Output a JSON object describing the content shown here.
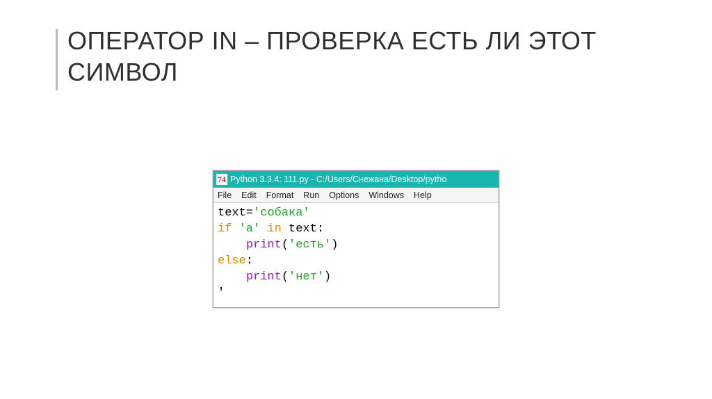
{
  "slide": {
    "title": "ОПЕРАТОР IN – ПРОВЕРКА ЕСТЬ ЛИ ЭТОТ СИМВОЛ"
  },
  "window": {
    "tk_icon": "74",
    "title": "Python 3.3.4: 111.py - C:/Users/Снежана/Desktop/pytho"
  },
  "menu": {
    "file": "File",
    "edit": "Edit",
    "format": "Format",
    "run": "Run",
    "options": "Options",
    "windows": "Windows",
    "help": "Help"
  },
  "code": {
    "l1_var": "text=",
    "l1_str": "'собака'",
    "l2_if": "if",
    "l2_sp1": " ",
    "l2_str": "'а'",
    "l2_sp2": " ",
    "l2_in": "in",
    "l2_sp3": " text:",
    "l3_indent": "    ",
    "l3_func": "print",
    "l3_paren_open": "(",
    "l3_str": "'есть'",
    "l3_paren_close": ")",
    "l4_else": "else",
    "l4_colon": ":",
    "l5_indent": "    ",
    "l5_func": "print",
    "l5_paren_open": "(",
    "l5_str": "'нет'",
    "l5_paren_close": ")",
    "cursor": "'"
  }
}
